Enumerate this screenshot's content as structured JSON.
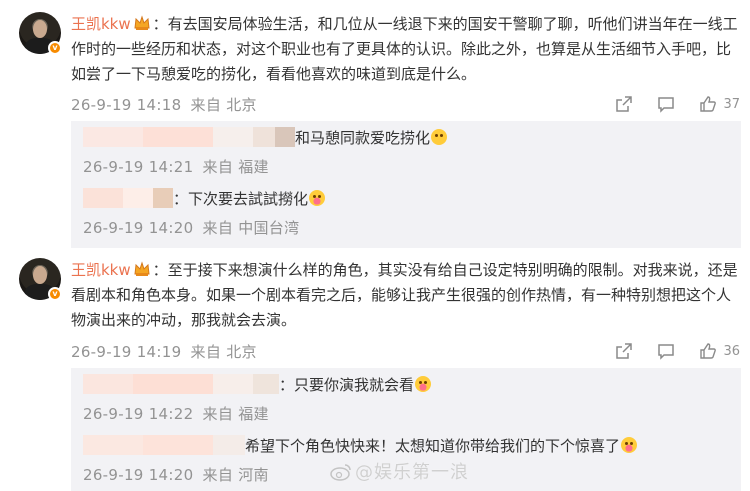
{
  "colors": {
    "username": "#eb7350",
    "meta": "#939393",
    "reply_bg": "#f2f2f5",
    "badge": "#f78b00"
  },
  "comments": [
    {
      "username": "王凯kkw",
      "text": "：有去国安局体验生活，和几位从一线退下来的国安干警聊了聊，听他们讲当年在一线工作时的一些经历和状态，对这个职业也有了更具体的认识。除此之外，也算是从生活细节入手吧，比如尝了一下马憩爱吃的捞化，看看他喜欢的味道到底是什么。",
      "time": "26-9-19 14:18",
      "location": "来自 北京",
      "likes": "37",
      "replies": [
        {
          "text": "和马憩同款爱吃捞化",
          "time": "26-9-19 14:21",
          "location": "来自 福建"
        },
        {
          "text": "：下次要去試試撈化",
          "time": "26-9-19 14:20",
          "location": "来自 中国台湾"
        }
      ]
    },
    {
      "username": "王凯kkw",
      "text": "：至于接下来想演什么样的角色，其实没有给自己设定特别明确的限制。对我来说，还是看剧本和角色本身。如果一个剧本看完之后，能够让我产生很强的创作热情，有一种特别想把这个人物演出来的冲动，那我就会去演。",
      "time": "26-9-19 14:19",
      "location": "来自 北京",
      "likes": "36",
      "replies": [
        {
          "text": "：只要你演我就会看",
          "time": "26-9-19 14:22",
          "location": "来自 福建"
        },
        {
          "text": "希望下个角色快快来！太想知道你带给我们的下个惊喜了",
          "time": "26-9-19 14:20",
          "location": "来自 河南"
        }
      ]
    }
  ],
  "watermark": "@娱乐第一浪",
  "icons": [
    "share-icon",
    "comment-icon",
    "like-icon",
    "crown-badge-icon",
    "verified-badge-icon",
    "emoji-icon",
    "weibo-logo-icon"
  ]
}
